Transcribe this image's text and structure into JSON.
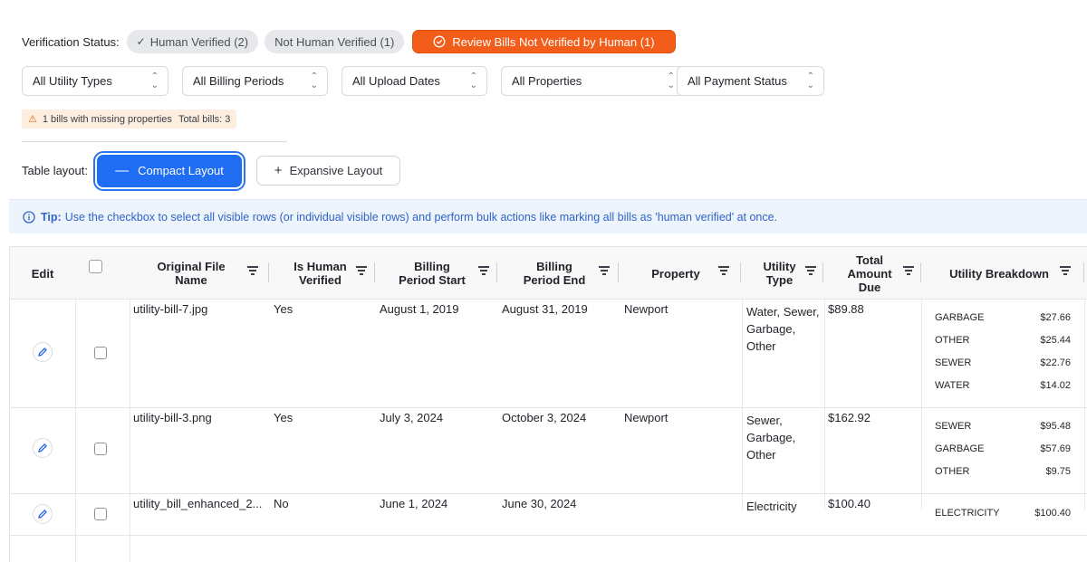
{
  "verification": {
    "label": "Verification Status:",
    "human_verified": "Human Verified (2)",
    "not_human_verified": "Not Human Verified (1)",
    "review": "Review Bills Not Verified by Human (1)"
  },
  "filters": [
    "All Utility Types",
    "All Billing Periods",
    "All Upload Dates",
    "All Properties",
    "All Payment Status"
  ],
  "warning": {
    "missing": "1 bills with missing properties",
    "total": "Total bills: 3"
  },
  "layout": {
    "label": "Table layout:",
    "compact": "Compact Layout",
    "expansive": "Expansive Layout"
  },
  "tip": {
    "title": "Tip:",
    "text": "Use the checkbox to select all visible rows (or individual visible rows) and perform bulk actions like marking all bills as 'human verified' at once."
  },
  "table": {
    "headers": {
      "edit": "Edit",
      "file": "Original File Name",
      "human": "Is Human Verified",
      "start": "Billing Period Start",
      "end": "Billing Period End",
      "property": "Property",
      "type": "Utility Type",
      "total": "Total Amount Due",
      "breakdown": "Utility Breakdown"
    },
    "rows": [
      {
        "file": "utility-bill-7.jpg",
        "human": "Yes",
        "start": "August 1, 2019",
        "end": "August 31, 2019",
        "property": "Newport",
        "type": "Water, Sewer, Garbage, Other",
        "total": "$89.88",
        "breakdown": [
          {
            "name": "GARBAGE",
            "amount": "$27.66"
          },
          {
            "name": "OTHER",
            "amount": "$25.44"
          },
          {
            "name": "SEWER",
            "amount": "$22.76"
          },
          {
            "name": "WATER",
            "amount": "$14.02"
          }
        ]
      },
      {
        "file": "utility-bill-3.png",
        "human": "Yes",
        "start": "July 3, 2024",
        "end": "October 3, 2024",
        "property": "Newport",
        "type": "Sewer, Garbage, Other",
        "total": "$162.92",
        "breakdown": [
          {
            "name": "SEWER",
            "amount": "$95.48"
          },
          {
            "name": "GARBAGE",
            "amount": "$57.69"
          },
          {
            "name": "OTHER",
            "amount": "$9.75"
          }
        ]
      },
      {
        "file": "utility_bill_enhanced_2...",
        "human": "No",
        "start": "June 1, 2024",
        "end": "June 30, 2024",
        "property": "",
        "type": "Electricity",
        "total": "$100.40",
        "breakdown": [
          {
            "name": "ELECTRICITY",
            "amount": "$100.40"
          }
        ]
      }
    ]
  },
  "colors": {
    "accent": "#1f6df2",
    "review": "#f25d1a",
    "tip": "#2e63c9",
    "warning_bg": "#fdeee0"
  },
  "icons": [
    "check-icon",
    "check-circle-icon",
    "chevron-updown-icon",
    "warning-icon",
    "minus-icon",
    "plus-icon",
    "info-icon",
    "filter-icon",
    "pencil-icon"
  ]
}
